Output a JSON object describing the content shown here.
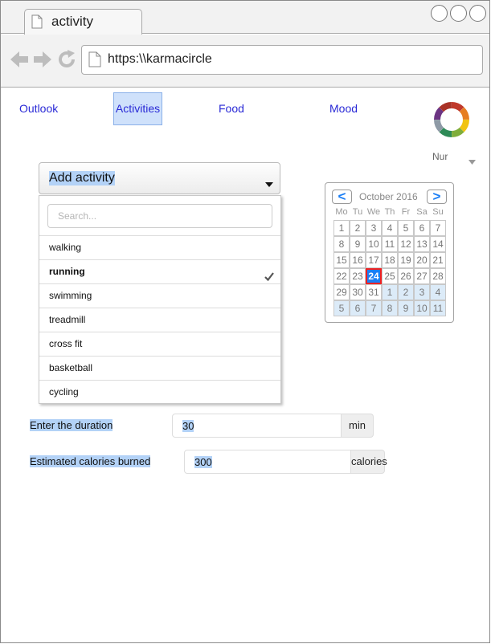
{
  "browser": {
    "tab_title": "activity",
    "url": "https:\\\\karmacircle"
  },
  "nav": {
    "items": [
      "Outlook",
      "Activities",
      "Food",
      "Mood"
    ],
    "active": "Activities"
  },
  "user": {
    "name": "Nur"
  },
  "activity_select": {
    "label": "Add activity",
    "search_placeholder": "Search...",
    "options": [
      "walking",
      "running",
      "swimming",
      "treadmill",
      "cross fit",
      "basketball",
      "cycling"
    ],
    "selected": "running"
  },
  "calendar": {
    "month_label": "October 2016",
    "prev_label": "<",
    "next_label": ">",
    "weekdays": [
      "Mo",
      "Tu",
      "We",
      "Th",
      "Fr",
      "Sa",
      "Su"
    ],
    "weeks": [
      [
        "1",
        "2",
        "3",
        "4",
        "5",
        "6",
        "7"
      ],
      [
        "8",
        "9",
        "10",
        "11",
        "12",
        "13",
        "14"
      ],
      [
        "15",
        "16",
        "17",
        "18",
        "19",
        "20",
        "21"
      ],
      [
        "22",
        "23",
        "24",
        "25",
        "26",
        "27",
        "28"
      ],
      [
        "29",
        "30",
        "31",
        "1",
        "2",
        "3",
        "4"
      ],
      [
        "5",
        "6",
        "7",
        "8",
        "9",
        "10",
        "11"
      ]
    ],
    "today": "24",
    "accent_color": "#1a7ef5",
    "today_border_color": "#e22222"
  },
  "duration": {
    "label": "Enter the duration",
    "value": "30",
    "unit": "min"
  },
  "calories": {
    "label": "Estimated calories burned",
    "value": "300",
    "unit": "calories"
  },
  "colors": {
    "link": "#2a2ad6",
    "highlight": "#b3d2f7",
    "active_nav_bg": "#cfe1fb"
  }
}
